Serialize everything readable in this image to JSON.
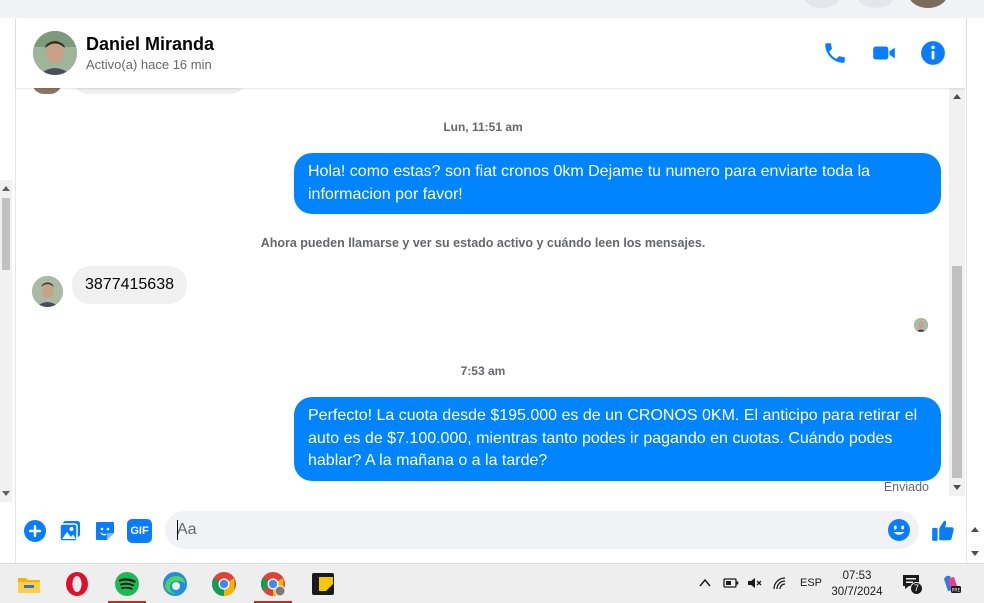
{
  "contact": {
    "name": "Daniel Miranda",
    "status": "Activo(a) hace 16 min"
  },
  "messages": {
    "timestamp_1": "Lun, 11:51 am",
    "outgoing_1": "Hola! como estas? son fiat cronos 0km Dejame tu numero para enviarte toda la informacion por favor!",
    "system_notice": "Ahora pueden llamarse y ver su estado activo y cuándo leen los mensajes.",
    "incoming_1": "3877415638",
    "timestamp_2": "7:53 am",
    "outgoing_2": "Perfecto! La cuota desde $195.000 es de un CRONOS 0KM. El anticipo para retirar el auto es de $7.100.000, mientras tanto podes ir pagando en cuotas. Cuándo podes hablar? A la mañana o a la tarde?",
    "sent_status": "Enviado"
  },
  "composer": {
    "placeholder": "Aa",
    "gif_label": "GIF"
  },
  "header_actions": [
    "phone-icon",
    "video-camera-icon",
    "info-icon"
  ],
  "composer_actions": [
    "plus-icon",
    "image-icon",
    "sticker-icon",
    "gif-icon",
    "emoji-icon",
    "thumbs-up-icon"
  ],
  "taskbar": {
    "apps": [
      "file-explorer-icon",
      "opera-icon",
      "spotify-icon",
      "edge-icon",
      "chrome-icon",
      "chrome-profile-icon",
      "sticky-notes-icon"
    ],
    "language": "ESP",
    "time": "07:53",
    "date": "30/7/2024",
    "notification_count": "7"
  },
  "colors": {
    "messenger_blue": "#0084ff",
    "icon_blue": "#0a7cff",
    "incoming_bubble": "#f0f0f0",
    "secondary_text": "#65676b"
  }
}
